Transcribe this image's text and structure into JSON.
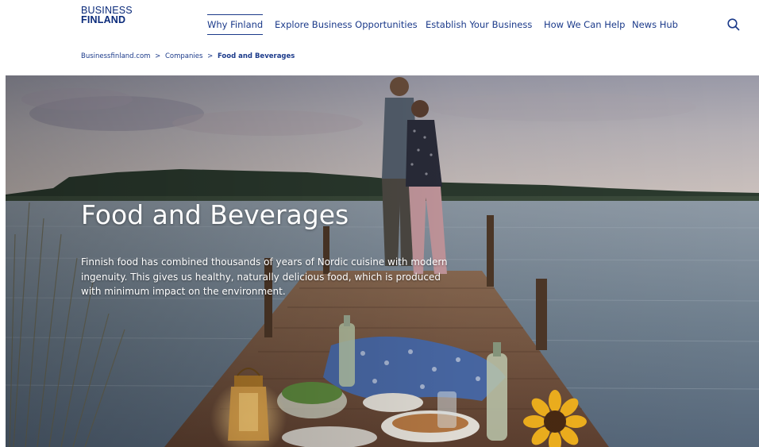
{
  "brand": {
    "line1": "BUSINESS",
    "line2": "FINLAND",
    "color": "#0a2a7a"
  },
  "nav": {
    "items": [
      {
        "label": "Why Finland",
        "active": true
      },
      {
        "label": "Explore Business Opportunities",
        "active": false
      },
      {
        "label": "Establish Your Business",
        "active": false
      },
      {
        "label": "How We Can Help",
        "active": false
      },
      {
        "label": "News Hub",
        "active": false
      }
    ],
    "search_icon": "search-icon"
  },
  "breadcrumb": {
    "items": [
      {
        "label": "Businessfinland.com"
      },
      {
        "label": "Companies"
      },
      {
        "label": "Food and Beverages"
      }
    ],
    "separator": ">"
  },
  "hero": {
    "title": "Food and Beverages",
    "description": "Finnish food has combined thousands of years of Nordic cuisine with modern ingenuity. This gives us healthy, naturally delicious food, which is produced with minimum impact on the environment."
  },
  "colors": {
    "accent": "#1b3a8a"
  }
}
